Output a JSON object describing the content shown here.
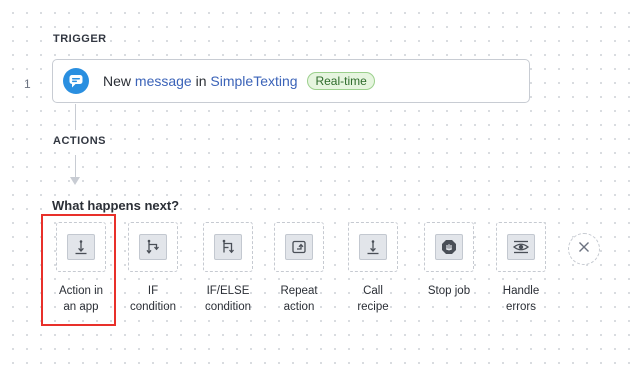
{
  "trigger": {
    "section_label": "TRIGGER",
    "step_number": "1",
    "prefix": "New ",
    "event": "message",
    "joiner": " in ",
    "app_name": "SimpleTexting",
    "badge": "Real-time",
    "app_icon": "chat-bubble-icon",
    "accent_color": "#2a8fe0"
  },
  "actions": {
    "section_label": "ACTIONS"
  },
  "next_step": {
    "question": "What happens next?",
    "options": [
      {
        "line1": "Action in",
        "line2": "an app",
        "icon": "action-in-app-icon",
        "selected": true
      },
      {
        "line1": "IF",
        "line2": "condition",
        "icon": "if-condition-icon"
      },
      {
        "line1": "IF/ELSE",
        "line2": "condition",
        "icon": "if-else-condition-icon"
      },
      {
        "line1": "Repeat",
        "line2": "action",
        "icon": "repeat-action-icon"
      },
      {
        "line1": "Call",
        "line2": "recipe",
        "icon": "call-recipe-icon"
      },
      {
        "line1": "Stop job",
        "line2": "",
        "icon": "stop-job-icon"
      },
      {
        "line1": "Handle",
        "line2": "errors",
        "icon": "handle-errors-icon"
      }
    ],
    "close_icon": "close-icon",
    "highlight_color": "#e8302a"
  }
}
